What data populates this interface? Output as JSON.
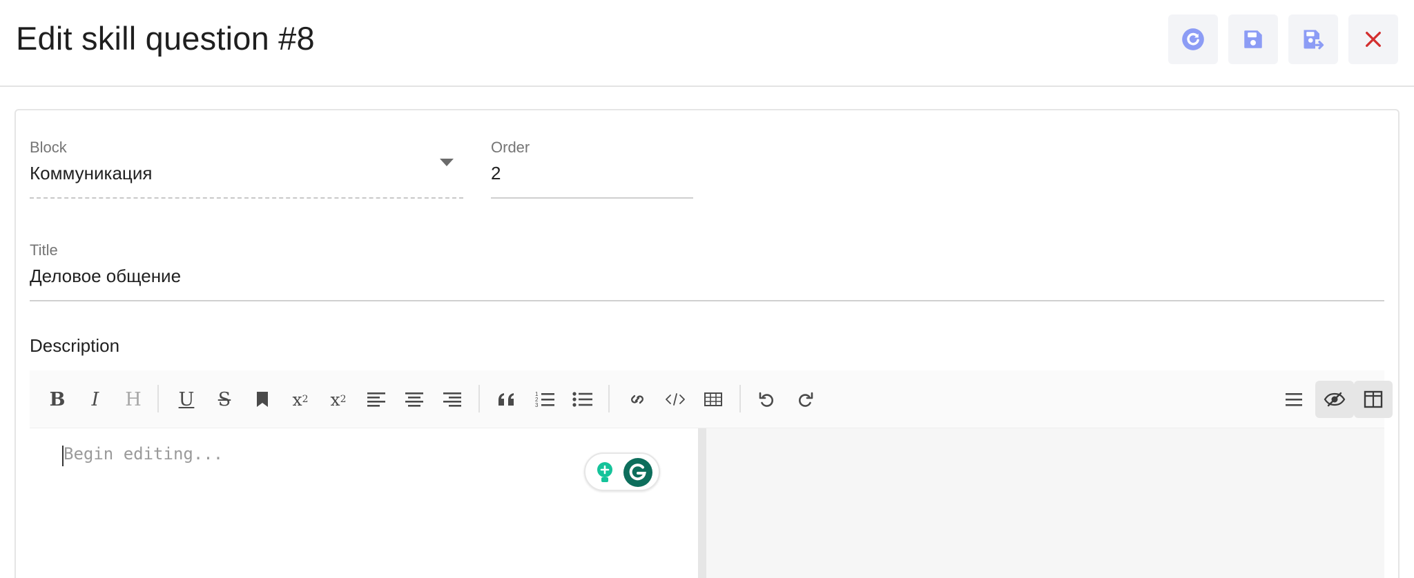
{
  "header": {
    "title": "Edit skill question #8",
    "buttons": {
      "reload": "reload-icon",
      "save": "save-icon",
      "save_close": "save-and-close-icon",
      "close": "close-icon"
    }
  },
  "form": {
    "block": {
      "label": "Block",
      "value": "Коммуникация"
    },
    "order": {
      "label": "Order",
      "value": "2"
    },
    "title": {
      "label": "Title",
      "value": "Деловое общение"
    },
    "description": {
      "label": "Description",
      "placeholder": "Begin editing...",
      "toolbar": {
        "bold": "B",
        "italic": "I",
        "heading": "H",
        "underline": "U",
        "strikethrough": "S",
        "superscript": "x",
        "superscript_mark": "2",
        "subscript": "x",
        "subscript_mark": "2"
      }
    }
  },
  "colors": {
    "accent": "#8c9cf5",
    "close": "#d32f2f",
    "grammarly": "#15c39a",
    "grammarly_dark": "#0d6e5c"
  }
}
